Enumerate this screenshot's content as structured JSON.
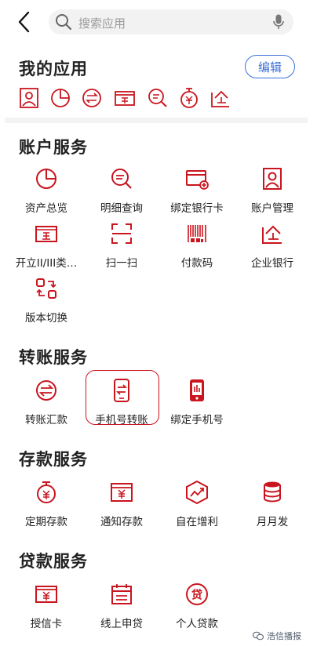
{
  "search": {
    "placeholder": "搜索应用"
  },
  "my_apps": {
    "title": "我的应用",
    "edit_label": "编辑",
    "mini_icons": [
      "account-manage-icon",
      "asset-overview-icon",
      "transfer-remit-icon",
      "open-account-icon",
      "detail-query-icon",
      "fixed-deposit-icon",
      "enterprise-bank-icon"
    ]
  },
  "account": {
    "title": "账户服务",
    "items": [
      "资产总览",
      "明细查询",
      "绑定银行卡",
      "账户管理",
      "开立II/III类…",
      "扫一扫",
      "付款码",
      "企业银行",
      "版本切换"
    ]
  },
  "transfer": {
    "title": "转账服务",
    "items": [
      "转账汇款",
      "手机号转账",
      "绑定手机号"
    ]
  },
  "deposit": {
    "title": "存款服务",
    "items": [
      "定期存款",
      "通知存款",
      "自在增利",
      "月月发"
    ]
  },
  "loan": {
    "title": "贷款服务",
    "items": [
      "授信卡",
      "线上申贷",
      "个人贷款"
    ]
  },
  "watermark": {
    "text": "浩信播报"
  },
  "colors": {
    "accent": "#c9151e",
    "edit_blue": "#3d6fd8"
  }
}
